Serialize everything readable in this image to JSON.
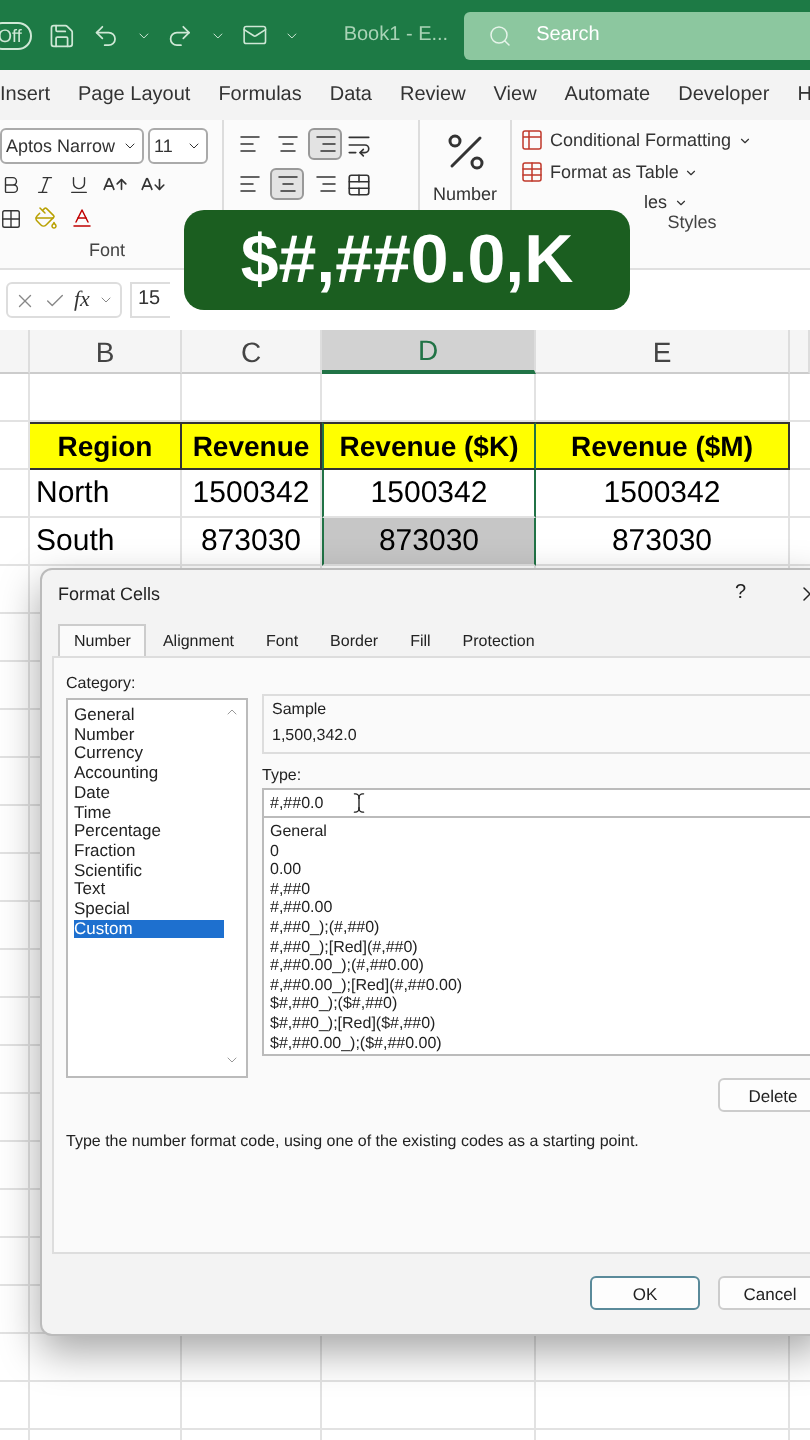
{
  "title_bar": {
    "autosave": "Off",
    "document": "Book1 - E...",
    "search_placeholder": "Search"
  },
  "ribbon_tabs": [
    "Insert",
    "Page Layout",
    "Formulas",
    "Data",
    "Review",
    "View",
    "Automate",
    "Developer",
    "H"
  ],
  "ribbon": {
    "font_name": "Aptos Narrow",
    "font_size": "11",
    "font_label": "Font",
    "alignment_buttons": [
      {
        "selected": false
      },
      {
        "selected": false
      },
      {
        "selected": true
      },
      {
        "selected": false
      },
      {
        "selected": true
      },
      {
        "selected": false
      }
    ],
    "number_label": "Number",
    "styles_items": [
      "Conditional Formatting",
      "Format as Table",
      "les"
    ],
    "styles_label": "Styles"
  },
  "formula_bar": {
    "fx": "fx",
    "value": "15"
  },
  "caption": "$#,##0.0,K",
  "sheet": {
    "columns": [
      {
        "label": "B",
        "selected": false
      },
      {
        "label": "C",
        "selected": false
      },
      {
        "label": "D",
        "selected": true
      },
      {
        "label": "E",
        "selected": false
      }
    ],
    "rows": [
      {
        "kind": "blank"
      },
      {
        "kind": "header",
        "cells": [
          {
            "text": "Region",
            "selected": false
          },
          {
            "text": "Revenue",
            "selected": false
          },
          {
            "text": "Revenue ($K)",
            "selected": false
          },
          {
            "text": "Revenue ($M)",
            "selected": false
          }
        ]
      },
      {
        "kind": "data",
        "cells": [
          {
            "text": "North",
            "selected": false
          },
          {
            "text": "1500342",
            "selected": false
          },
          {
            "text": "1500342",
            "selected": false
          },
          {
            "text": "1500342",
            "selected": false
          }
        ]
      },
      {
        "kind": "data",
        "cells": [
          {
            "text": "South",
            "selected": false
          },
          {
            "text": "873030",
            "selected": false
          },
          {
            "text": "873030",
            "selected": true
          },
          {
            "text": "873030",
            "selected": false
          }
        ]
      }
    ]
  },
  "dialog": {
    "title": "Format Cells",
    "help": "?",
    "tabs": [
      {
        "label": "Number",
        "selected": true
      },
      {
        "label": "Alignment",
        "selected": false
      },
      {
        "label": "Font",
        "selected": false
      },
      {
        "label": "Border",
        "selected": false
      },
      {
        "label": "Fill",
        "selected": false
      },
      {
        "label": "Protection",
        "selected": false
      }
    ],
    "category_label": "Category:",
    "categories": [
      {
        "label": "General",
        "selected": false
      },
      {
        "label": "Number",
        "selected": false
      },
      {
        "label": "Currency",
        "selected": false
      },
      {
        "label": "Accounting",
        "selected": false
      },
      {
        "label": "Date",
        "selected": false
      },
      {
        "label": "Time",
        "selected": false
      },
      {
        "label": "Percentage",
        "selected": false
      },
      {
        "label": "Fraction",
        "selected": false
      },
      {
        "label": "Scientific",
        "selected": false
      },
      {
        "label": "Text",
        "selected": false
      },
      {
        "label": "Special",
        "selected": false
      },
      {
        "label": "Custom",
        "selected": true
      }
    ],
    "sample_label": "Sample",
    "sample_value": "1,500,342.0",
    "type_label": "Type:",
    "type_value": "#,##0.0",
    "type_list": [
      "General",
      "0",
      "0.00",
      "#,##0",
      "#,##0.00",
      "#,##0_);(#,##0)",
      "#,##0_);[Red](#,##0)",
      "#,##0.00_);(#,##0.00)",
      "#,##0.00_);[Red](#,##0.00)",
      "$#,##0_);($#,##0)",
      "$#,##0_);[Red]($#,##0)",
      "$#,##0.00_);($#,##0.00)"
    ],
    "delete_button": "Delete",
    "description": "Type the number format code, using one of the existing codes as a starting point.",
    "ok_button": "OK",
    "cancel_button": "Cancel"
  }
}
